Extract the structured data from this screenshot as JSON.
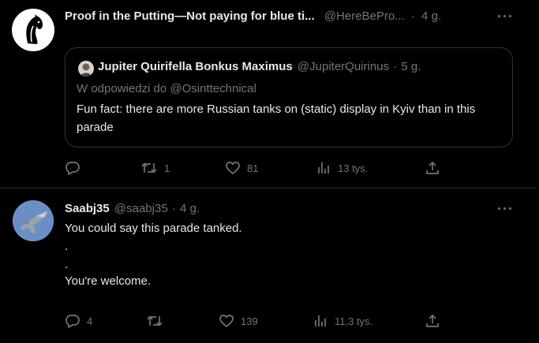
{
  "tweet1": {
    "title": "Proof in the Putting—Not paying for blue ti...",
    "handle": "@HereBePro...",
    "sep": "·",
    "time": "4 g.",
    "quote": {
      "name": "Jupiter Quirifella Bonkus Maximus",
      "handle": "@JupiterQuirinus",
      "sep": "·",
      "time": "5 g.",
      "reply_to": "W odpowiedzi do @Osinttechnical",
      "text": "Fun fact: there are more Russian tanks on (static) display in Kyiv than in this parade"
    },
    "actions": {
      "replies": "",
      "retweets": "1",
      "likes": "81",
      "views": "13 tys."
    }
  },
  "tweet2": {
    "name": "Saabj35",
    "handle": "@saabj35",
    "sep": "·",
    "time": "4 g.",
    "lines": [
      "You could say this parade tanked.",
      ".",
      ".",
      "You're welcome."
    ],
    "actions": {
      "replies": "4",
      "retweets": "",
      "likes": "139",
      "views": "11,3 tys."
    }
  },
  "colors": {
    "background": "#000000",
    "text": "#e7e9ea",
    "muted": "#71767b",
    "border": "#2f3336"
  }
}
